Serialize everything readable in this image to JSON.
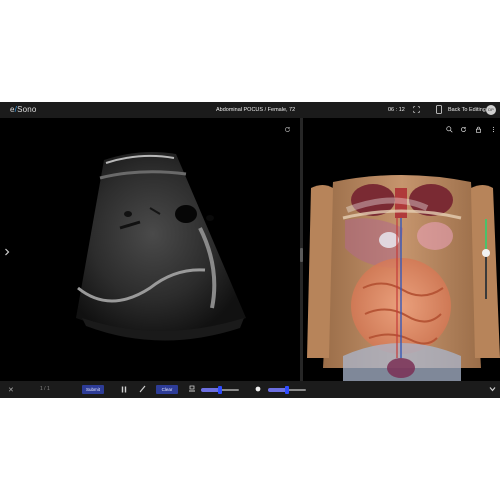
{
  "app": {
    "logo": {
      "prefix": "e",
      "accent": "/",
      "name": "Sono"
    },
    "title": "Abdominal POCUS  /  Female, 72",
    "timer": "06 : 12",
    "back_label": "Back To Editing",
    "avatar_initials": "DP"
  },
  "bottom": {
    "close": "✕",
    "pager": "1 / 1",
    "submit_label": "Submit",
    "clear_label": "Clear",
    "gain_slider_level": 0.5,
    "depth_slider_level": 0.5
  },
  "anatomy": {
    "opacity_slider_level": 0.42
  },
  "colors": {
    "topbar": "#1b1b1b",
    "accent": "#3aa0e8",
    "button": "#2d3c97",
    "slider_green": "#49c16b",
    "slider_blue": "#2f4cff"
  },
  "icons": [
    "refresh-icon",
    "fullscreen-icon",
    "phone-icon",
    "zoom-icon",
    "reset-icon",
    "lock-icon",
    "more-icon",
    "pause-icon",
    "pen-icon",
    "probe-icon",
    "brightness-icon",
    "chevron-down-icon",
    "chevron-right-icon"
  ]
}
